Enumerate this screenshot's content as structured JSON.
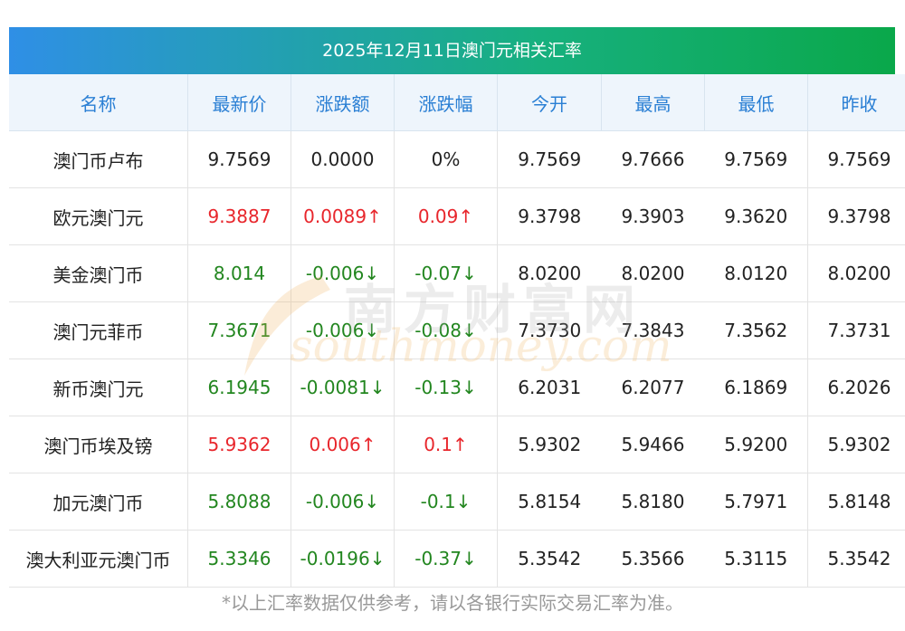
{
  "title": "2025年12月11日澳门元相关汇率",
  "columns": [
    "名称",
    "最新价",
    "涨跌额",
    "涨跌幅",
    "今开",
    "最高",
    "最低",
    "昨收"
  ],
  "rows": [
    {
      "name": "澳门币卢布",
      "latest": "9.7569",
      "change": "0.0000",
      "pct": "0%",
      "open": "9.7569",
      "high": "9.7666",
      "low": "9.7569",
      "close": "9.7569",
      "dir": "flat"
    },
    {
      "name": "欧元澳门元",
      "latest": "9.3887",
      "change": "0.0089↑",
      "pct": "0.09↑",
      "open": "9.3798",
      "high": "9.3903",
      "low": "9.3620",
      "close": "9.3798",
      "dir": "up"
    },
    {
      "name": "美金澳门币",
      "latest": "8.014",
      "change": "-0.006↓",
      "pct": "-0.07↓",
      "open": "8.0200",
      "high": "8.0200",
      "low": "8.0120",
      "close": "8.0200",
      "dir": "down"
    },
    {
      "name": "澳门元菲币",
      "latest": "7.3671",
      "change": "-0.006↓",
      "pct": "-0.08↓",
      "open": "7.3730",
      "high": "7.3843",
      "low": "7.3562",
      "close": "7.3731",
      "dir": "down"
    },
    {
      "name": "新币澳门元",
      "latest": "6.1945",
      "change": "-0.0081↓",
      "pct": "-0.13↓",
      "open": "6.2031",
      "high": "6.2077",
      "low": "6.1869",
      "close": "6.2026",
      "dir": "down"
    },
    {
      "name": "澳门币埃及镑",
      "latest": "5.9362",
      "change": "0.006↑",
      "pct": "0.1↑",
      "open": "5.9302",
      "high": "5.9466",
      "low": "5.9200",
      "close": "5.9302",
      "dir": "up"
    },
    {
      "name": "加元澳门币",
      "latest": "5.8088",
      "change": "-0.006↓",
      "pct": "-0.1↓",
      "open": "5.8154",
      "high": "5.8180",
      "low": "5.7971",
      "close": "5.8148",
      "dir": "down"
    },
    {
      "name": "澳大利亚元澳门币",
      "latest": "5.3346",
      "change": "-0.0196↓",
      "pct": "-0.37↓",
      "open": "5.3542",
      "high": "5.3566",
      "low": "5.3115",
      "close": "5.3542",
      "dir": "down"
    }
  ],
  "footnote": "*以上汇率数据仅供参考，请以各银行实际交易汇率为准。",
  "watermark": {
    "cn": "南方财富网",
    "en": "southmoney.com"
  },
  "colors": {
    "up": "#e8262c",
    "down": "#22861f",
    "header_text": "#2a7fd4",
    "title_gradient_start": "#2f8fe6",
    "title_gradient_end": "#0aa84a"
  }
}
